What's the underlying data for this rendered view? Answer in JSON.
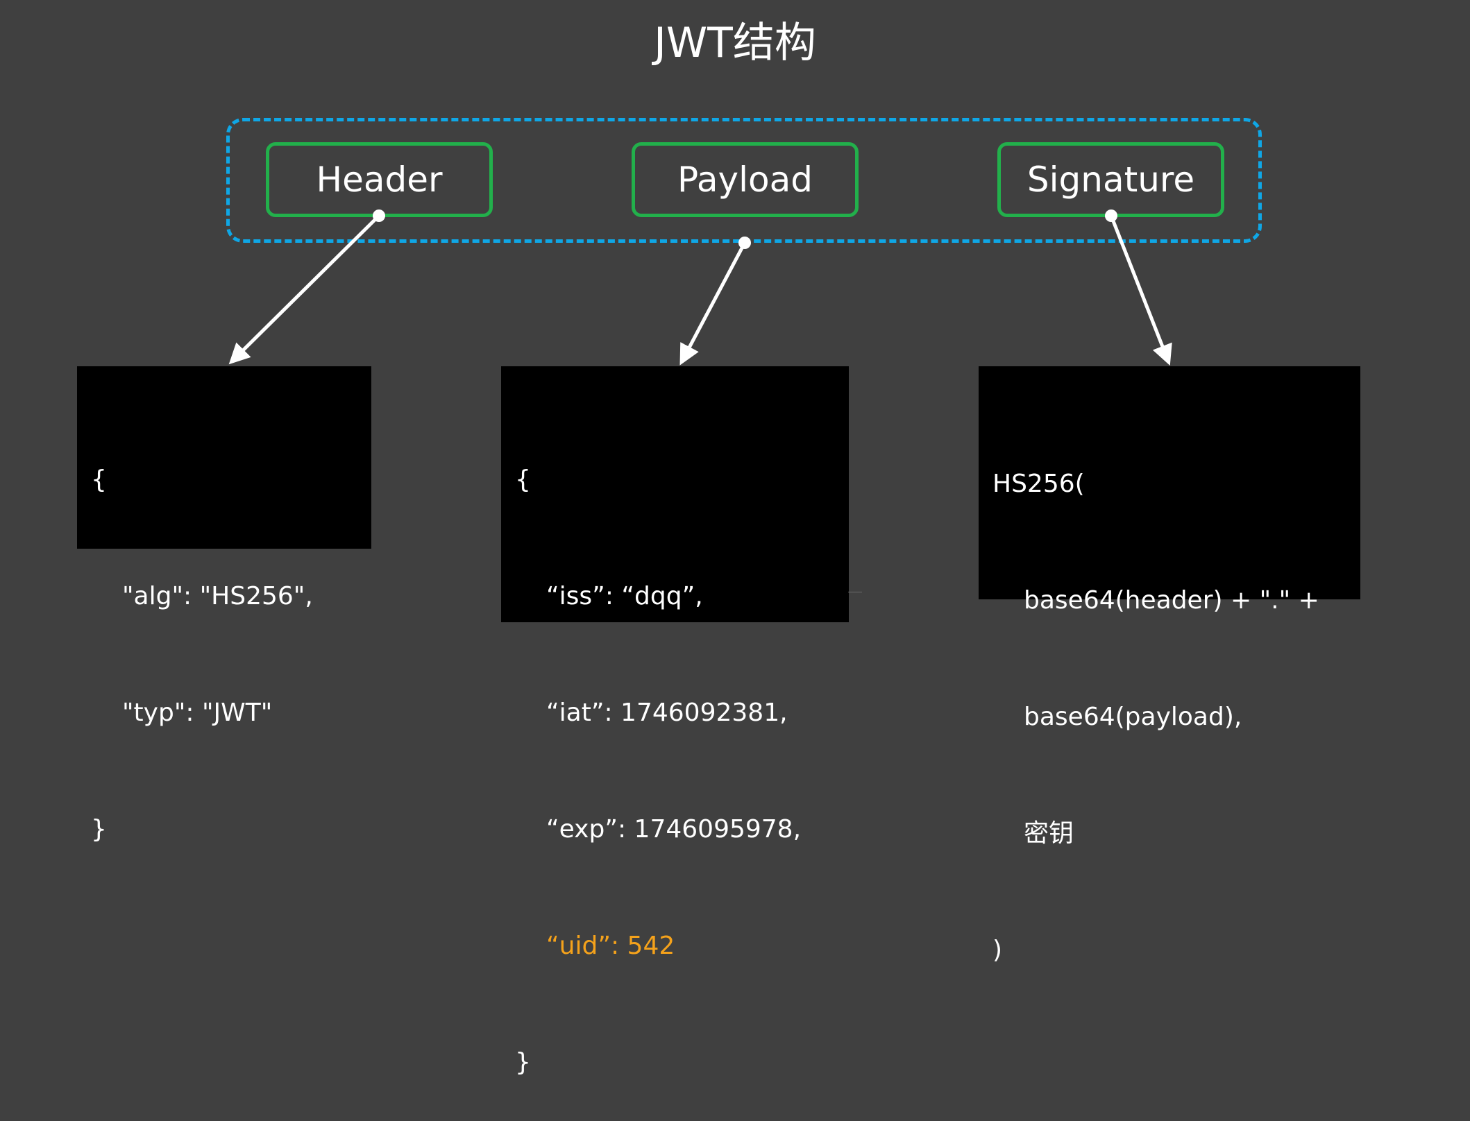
{
  "title": "JWT结构",
  "parts": {
    "header": "Header",
    "payload": "Payload",
    "signature": "Signature"
  },
  "header_code": [
    "{",
    "\"alg\": \"HS256\",",
    "\"typ\": \"JWT\"",
    "}"
  ],
  "payload_code": [
    "{",
    "“iss”: “dqq”,",
    "“iat”: 1746092381,",
    "“exp”: 1746095978,",
    "“uid”: 542",
    "}"
  ],
  "signature_code": [
    "HS256(",
    "base64(header) + \".\" +",
    "base64(payload),",
    "密钥",
    ")"
  ],
  "colors": {
    "background": "#404040",
    "group_border": "#0fa7e6",
    "part_border": "#22b04b",
    "highlight": "#f5a21b",
    "code_bg": "#000000"
  }
}
